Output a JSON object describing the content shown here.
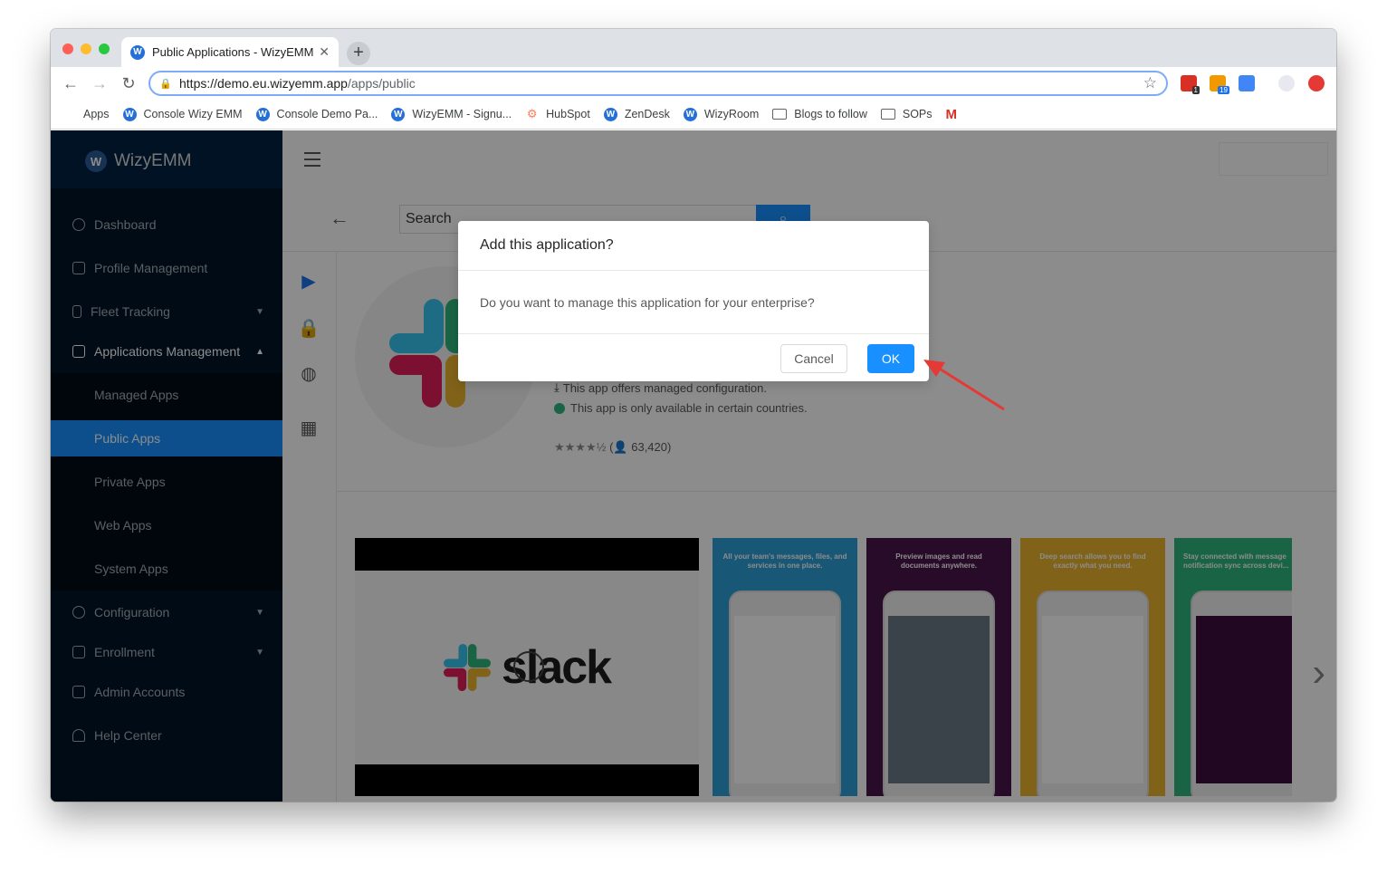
{
  "browser": {
    "tab_title": "Public Applications - WizyEMM",
    "tab_favicon_letter": "W",
    "url_base": "https://demo.eu.wizyemm.app",
    "url_path": "/apps/public",
    "traffic_colors": [
      "#fe5f57",
      "#febc2e",
      "#28c840"
    ],
    "extension_badges": [
      "1",
      "19"
    ]
  },
  "bookmarks": [
    {
      "label": "Apps",
      "icon": "apps-grid-icon"
    },
    {
      "label": "Console Wizy EMM",
      "icon": "wizy-icon"
    },
    {
      "label": "Console Demo Pa...",
      "icon": "wizy-icon"
    },
    {
      "label": "WizyEMM - Signu...",
      "icon": "wizy-icon"
    },
    {
      "label": "HubSpot",
      "icon": "hubspot-icon"
    },
    {
      "label": "ZenDesk",
      "icon": "wizy-icon"
    },
    {
      "label": "WizyRoom",
      "icon": "wizy-icon"
    },
    {
      "label": "Blogs to follow",
      "icon": "folder-icon"
    },
    {
      "label": "SOPs",
      "icon": "folder-icon"
    },
    {
      "label": "M",
      "icon": "gmail-icon"
    }
  ],
  "sidebar": {
    "logo_text": "WizyEMM",
    "logo_letter": "W",
    "items": [
      {
        "label": "Dashboard"
      },
      {
        "label": "Profile Management"
      },
      {
        "label": "Fleet Tracking"
      },
      {
        "label": "Applications Management"
      },
      {
        "label": "Managed Apps"
      },
      {
        "label": "Public Apps"
      },
      {
        "label": "Private Apps"
      },
      {
        "label": "Web Apps"
      },
      {
        "label": "System Apps"
      },
      {
        "label": "Configuration"
      },
      {
        "label": "Enrollment"
      },
      {
        "label": "Admin Accounts"
      },
      {
        "label": "Help Center"
      }
    ]
  },
  "search": {
    "placeholder": "Search"
  },
  "app_detail": {
    "managed_config": "This app offers managed configuration.",
    "countries": "This app is only available in certain countries.",
    "rating_count": "63,420",
    "video_word": "slack",
    "screenshots": [
      {
        "caption": "All your team's messages, files, and services in one place.",
        "color": "#2e9fd9"
      },
      {
        "caption": "Preview images and read documents anywhere.",
        "color": "#4a154b"
      },
      {
        "caption": "Deep search allows you to find exactly what you need.",
        "color": "#ecb22e"
      },
      {
        "caption": "Stay connected with message notification sync across devi...",
        "color": "#2eb67d"
      }
    ],
    "colors": {
      "blue": "#36c5f0",
      "green": "#2eb67d",
      "red": "#e01e5a",
      "yellow": "#ecb22e"
    }
  },
  "modal": {
    "title": "Add this application?",
    "body": "Do you want to manage this application for your enterprise?",
    "cancel_label": "Cancel",
    "ok_label": "OK"
  },
  "accent": "#1890ff",
  "annotation_color": "#e53935"
}
